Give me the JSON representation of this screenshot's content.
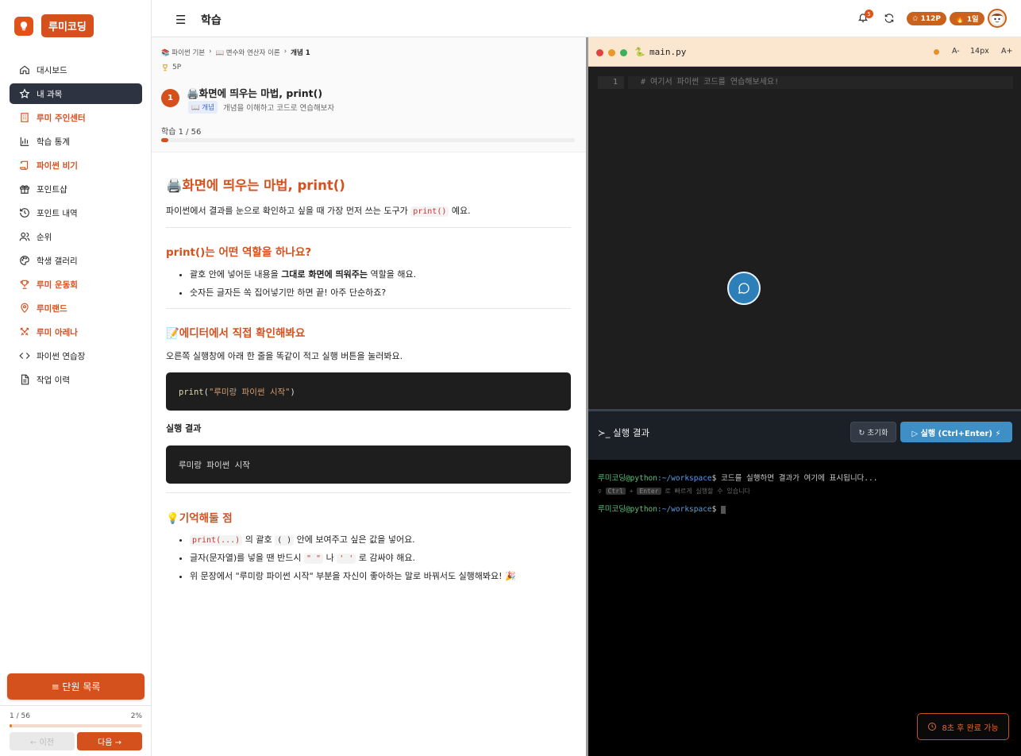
{
  "app": {
    "logo_text": "루미코딩"
  },
  "sidebar": {
    "items": [
      {
        "label": "대시보드",
        "icon": "home-icon"
      },
      {
        "label": "내 과목",
        "icon": "star-icon"
      },
      {
        "label": "루미 주인센터",
        "icon": "building-icon"
      },
      {
        "label": "학습 통계",
        "icon": "bar-chart-icon"
      },
      {
        "label": "파이썬 비기",
        "icon": "scroll-icon"
      },
      {
        "label": "포인트샵",
        "icon": "gift-icon"
      },
      {
        "label": "포인트 내역",
        "icon": "history-icon"
      },
      {
        "label": "순위",
        "icon": "users-icon"
      },
      {
        "label": "학생 갤러리",
        "icon": "palette-icon"
      },
      {
        "label": "루미 운동회",
        "icon": "trophy-icon"
      },
      {
        "label": "루미랜드",
        "icon": "map-pin-icon"
      },
      {
        "label": "루미 아레나",
        "icon": "swords-icon"
      },
      {
        "label": "파이썬 연습장",
        "icon": "code-icon"
      },
      {
        "label": "작업 이력",
        "icon": "file-icon"
      }
    ],
    "unit_list_button": "≡ 단원 목록",
    "progress_left": "1 / 56",
    "progress_right": "2%",
    "progress_fraction": 0.02,
    "prev_button": "← 이전",
    "next_button": "다음 →"
  },
  "header": {
    "title": "학습",
    "notification_count": "5",
    "points_pill": "✩ 112P",
    "streak_pill": "🔥 1일"
  },
  "lesson": {
    "breadcrumb": [
      "📚 파이썬 기본",
      "📖 변수와 연산자 이론",
      "개념 1"
    ],
    "points": "5P",
    "step_number": "1",
    "title": "🖨️화면에 띄우는 마법, print()",
    "badge": "📖 개념",
    "description": "개념을 이해하고 코드로 연습해보자",
    "progress_label": "학습 1 / 56",
    "progress_fraction": 0.018,
    "heading1": "🖨️화면에 띄우는 마법, print()",
    "intro_before": "파이썬에서 결과를 눈으로 확인하고 싶을 때 가장 먼저 쓰는 도구가 ",
    "intro_code": "print()",
    "intro_after": " 예요.",
    "heading2": "print()는 어떤 역할을 하나요?",
    "role_item1_before": "괄호 안에 넣어둔 내용을 ",
    "role_item1_bold": "그대로 화면에 띄워주는",
    "role_item1_after": " 역할을 해요.",
    "role_item2": "숫자든 글자든 쏙 집어넣기만 하면 끝! 아주 단순하죠?",
    "heading3": "📝에디터에서 직접 확인해봐요",
    "instruction": "오른쪽 실행창에 아래 한 줄을 똑같이 적고 실행 버튼을 눌러봐요.",
    "code_fn": "print",
    "code_open": "(",
    "code_str": "\"루미랑 파이썬 시작\"",
    "code_close": ")",
    "result_label": "실행 결과",
    "result_output": "루미랑 파이썬 시작",
    "heading4": "💡기억해둘 점",
    "tip1_code": "print(...)",
    "tip1_mid": " 의 괄호 ",
    "tip1_code2": "( )",
    "tip1_after": " 안에 보여주고 싶은 값을 넣어요.",
    "tip2_before": "글자(문자열)를 넣을 땐 반드시 ",
    "tip2_code1": "\" \"",
    "tip2_mid": " 나 ",
    "tip2_code2": "' '",
    "tip2_after": " 로 감싸야 해요.",
    "tip3": "위 문장에서 \"루미랑 파이썬 시작\" 부분을 자신이 좋아하는 말로 바꿔서도 실행해봐요! 🎉"
  },
  "editor": {
    "file_name": "main.py",
    "font_decrease": "A-",
    "font_size": "14px",
    "font_increase": "A+",
    "line_number": "1",
    "code_line": "# 여기서 파이썬 코드를 연습해보세요!",
    "output_title": "실행 결과",
    "reset_button": "↻ 초기화",
    "run_button": "▷ 실행 (Ctrl+Enter) ⚡",
    "terminal_user": "루미코딩@python",
    "terminal_path": ":~/workspace",
    "terminal_prompt": "$",
    "terminal_message": " 코드를 실행하면 결과가 여기에 표시됩니다...",
    "hint_icon": "♀",
    "hint_ctrl": "Ctrl",
    "hint_plus": "+",
    "hint_enter": "Enter",
    "hint_text": "로 빠르게 실행할 수 있습니다",
    "complete_button": "8초 후 완료 가능"
  }
}
